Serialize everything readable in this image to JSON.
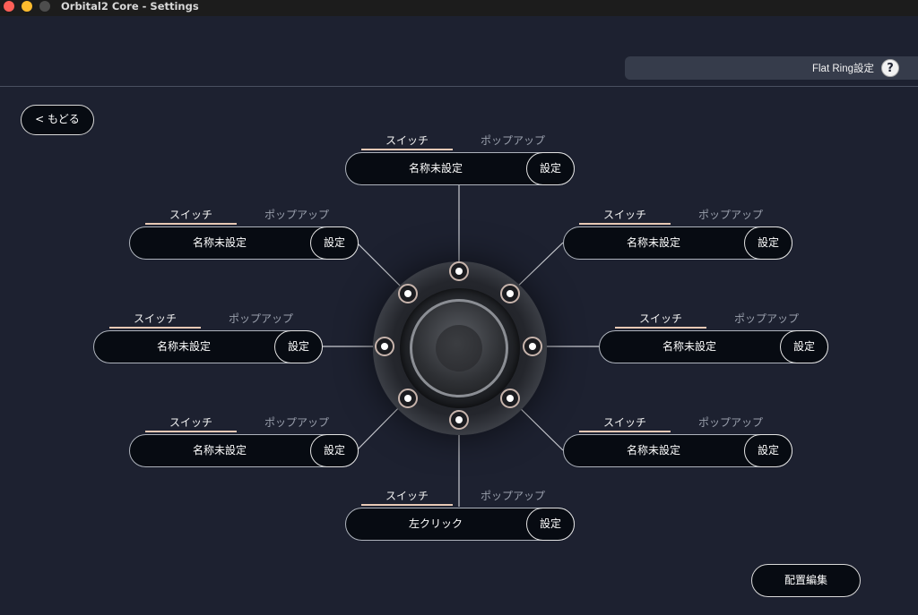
{
  "window": {
    "title": "Orbital2 Core - Settings"
  },
  "header": {
    "mode_label": "Flat Ring設定",
    "help_glyph": "?"
  },
  "nav": {
    "back_label": "< もどる"
  },
  "tabs": {
    "switch_label": "スイッチ",
    "popup_label": "ポップアップ"
  },
  "slots": [
    {
      "name": "名称未設定",
      "set_label": "設定",
      "active_tab": "switch"
    },
    {
      "name": "名称未設定",
      "set_label": "設定",
      "active_tab": "switch"
    },
    {
      "name": "名称未設定",
      "set_label": "設定",
      "active_tab": "switch"
    },
    {
      "name": "名称未設定",
      "set_label": "設定",
      "active_tab": "switch"
    },
    {
      "name": "左クリック",
      "set_label": "設定",
      "active_tab": "switch"
    },
    {
      "name": "名称未設定",
      "set_label": "設定",
      "active_tab": "switch"
    },
    {
      "name": "名称未設定",
      "set_label": "設定",
      "active_tab": "switch"
    },
    {
      "name": "名称未設定",
      "set_label": "設定",
      "active_tab": "switch"
    }
  ],
  "footer": {
    "layout_edit_label": "配置編集"
  },
  "colors": {
    "background": "#1d2130",
    "accent_underline": "#e8c9b5",
    "inactive_tab": "#9aa0ad",
    "dot_ring": "#c7b4ac"
  }
}
